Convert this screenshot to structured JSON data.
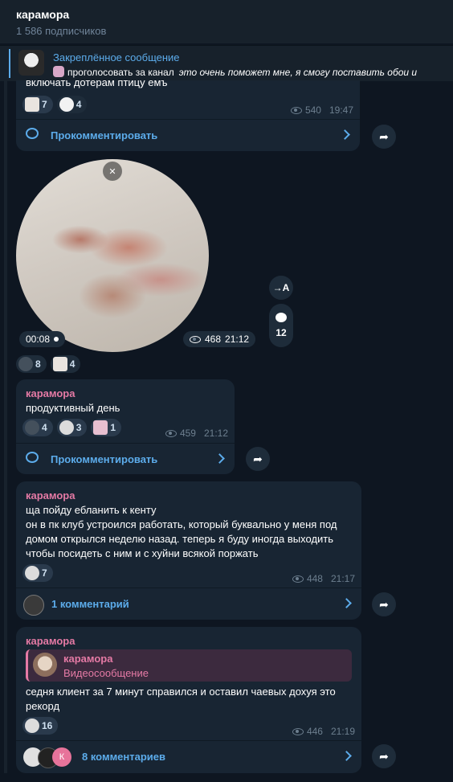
{
  "channel": {
    "title": "карамора",
    "subscribers": "1 586 подписчиков"
  },
  "pinned": {
    "title": "Закреплённое сообщение",
    "text": "проголосовать за канал",
    "text_italic": "это очень поможет мне, я смогу поставить обои и"
  },
  "post1": {
    "text": "включать дотерам птицу емъ",
    "reactions": [
      {
        "emoji": "love-sticker",
        "count": "7"
      },
      {
        "emoji": "hellokitty-sticker",
        "count": "4"
      }
    ],
    "views": "540",
    "time": "19:47",
    "comment_label": "Прокомментировать"
  },
  "video_post": {
    "duration": "00:08",
    "views": "468",
    "time": "21:12",
    "translate_label": "→A",
    "comments_count": "12",
    "reactions": [
      {
        "emoji": "cross-sticker",
        "count": "8"
      },
      {
        "emoji": "love-sticker",
        "count": "4"
      }
    ]
  },
  "post2": {
    "author": "карамора",
    "text": "продуктивный день",
    "reactions": [
      {
        "emoji": "cross-sticker",
        "count": "4"
      },
      {
        "emoji": "cat-sticker",
        "count": "3"
      },
      {
        "emoji": "pink-sticker",
        "count": "1"
      }
    ],
    "views": "459",
    "time": "21:12",
    "comment_label": "Прокомментировать"
  },
  "post3": {
    "author": "карамора",
    "lines": [
      "ща пойду ебланить к кенту",
      "он в пк клуб устроился работать, который буквально у меня под",
      "домом открылся неделю назад. теперь я буду иногда выходить",
      "чтобы посидеть с ним и с хуйни всякой поржать"
    ],
    "reactions": [
      {
        "emoji": "cat-sticker",
        "count": "7"
      }
    ],
    "views": "448",
    "time": "21:17",
    "comment_label": "1 комментарий"
  },
  "post4": {
    "author": "карамора",
    "reply": {
      "name": "карамора",
      "subtitle": "Видеосообщение"
    },
    "lines": [
      "седня клиент за 7 минут справился и оставил чаевых дохуя это",
      "рекорд"
    ],
    "reactions": [
      {
        "emoji": "cat-sticker",
        "count": "16"
      }
    ],
    "views": "446",
    "time": "21:19",
    "commenter_initial": "К",
    "comment_label": "8 комментариев"
  },
  "colors": {
    "bg": "#0e1621",
    "bubble": "#182533",
    "accent": "#5caceb",
    "author": "#e57aa5"
  }
}
